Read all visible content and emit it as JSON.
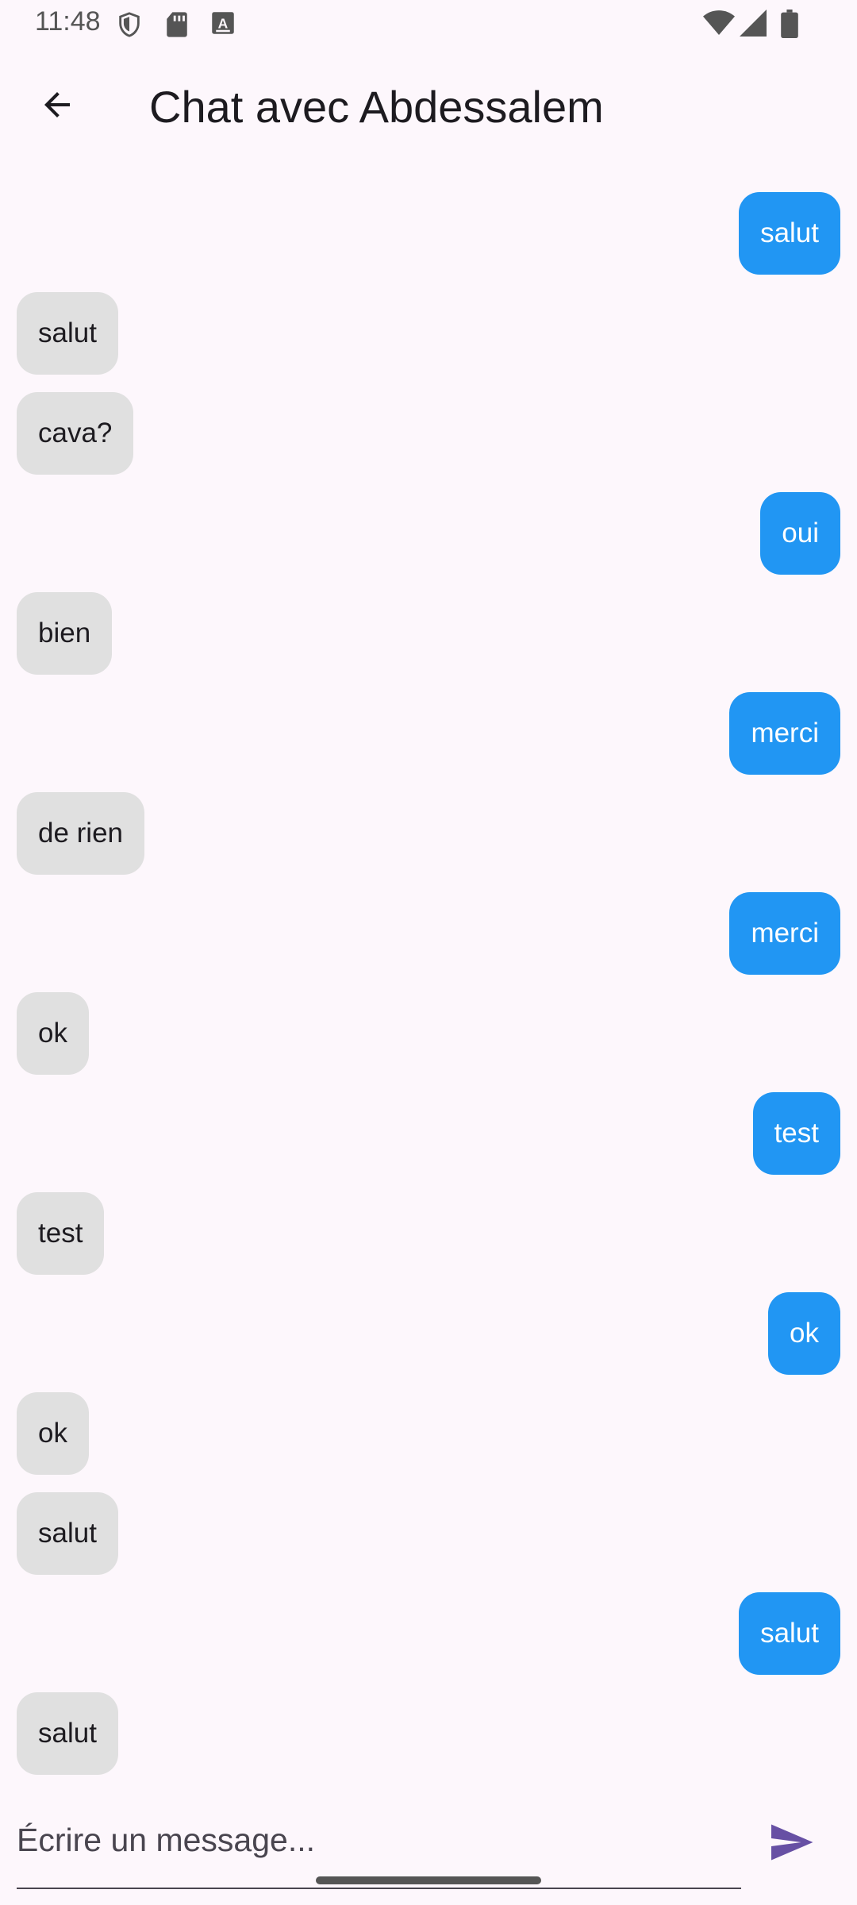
{
  "status_bar": {
    "time": "11:48",
    "left_icons": [
      "shield-icon",
      "sd-card-icon",
      "keyboard-a-icon"
    ],
    "right_icons": [
      "wifi-icon",
      "cell-signal-icon",
      "battery-icon"
    ]
  },
  "app_bar": {
    "title": "Chat avec Abdessalem",
    "back_icon": "arrow-back-icon"
  },
  "messages": [
    {
      "text": "salut",
      "sender": "me"
    },
    {
      "text": "salut",
      "sender": "other"
    },
    {
      "text": "cava?",
      "sender": "other"
    },
    {
      "text": "oui",
      "sender": "me"
    },
    {
      "text": "bien",
      "sender": "other"
    },
    {
      "text": "merci",
      "sender": "me"
    },
    {
      "text": "de rien",
      "sender": "other"
    },
    {
      "text": "merci",
      "sender": "me"
    },
    {
      "text": "ok",
      "sender": "other"
    },
    {
      "text": "test",
      "sender": "me"
    },
    {
      "text": "test",
      "sender": "other"
    },
    {
      "text": "ok",
      "sender": "me"
    },
    {
      "text": "ok",
      "sender": "other"
    },
    {
      "text": "salut",
      "sender": "other"
    },
    {
      "text": "salut",
      "sender": "me"
    },
    {
      "text": "salut",
      "sender": "other"
    }
  ],
  "composer": {
    "placeholder": "Écrire un message...",
    "value": "",
    "send_icon": "send-icon"
  },
  "colors": {
    "background": "#FDF7FC",
    "sent_bubble": "#2196F3",
    "received_bubble": "#E0E0E0",
    "send_icon": "#6750A4"
  }
}
